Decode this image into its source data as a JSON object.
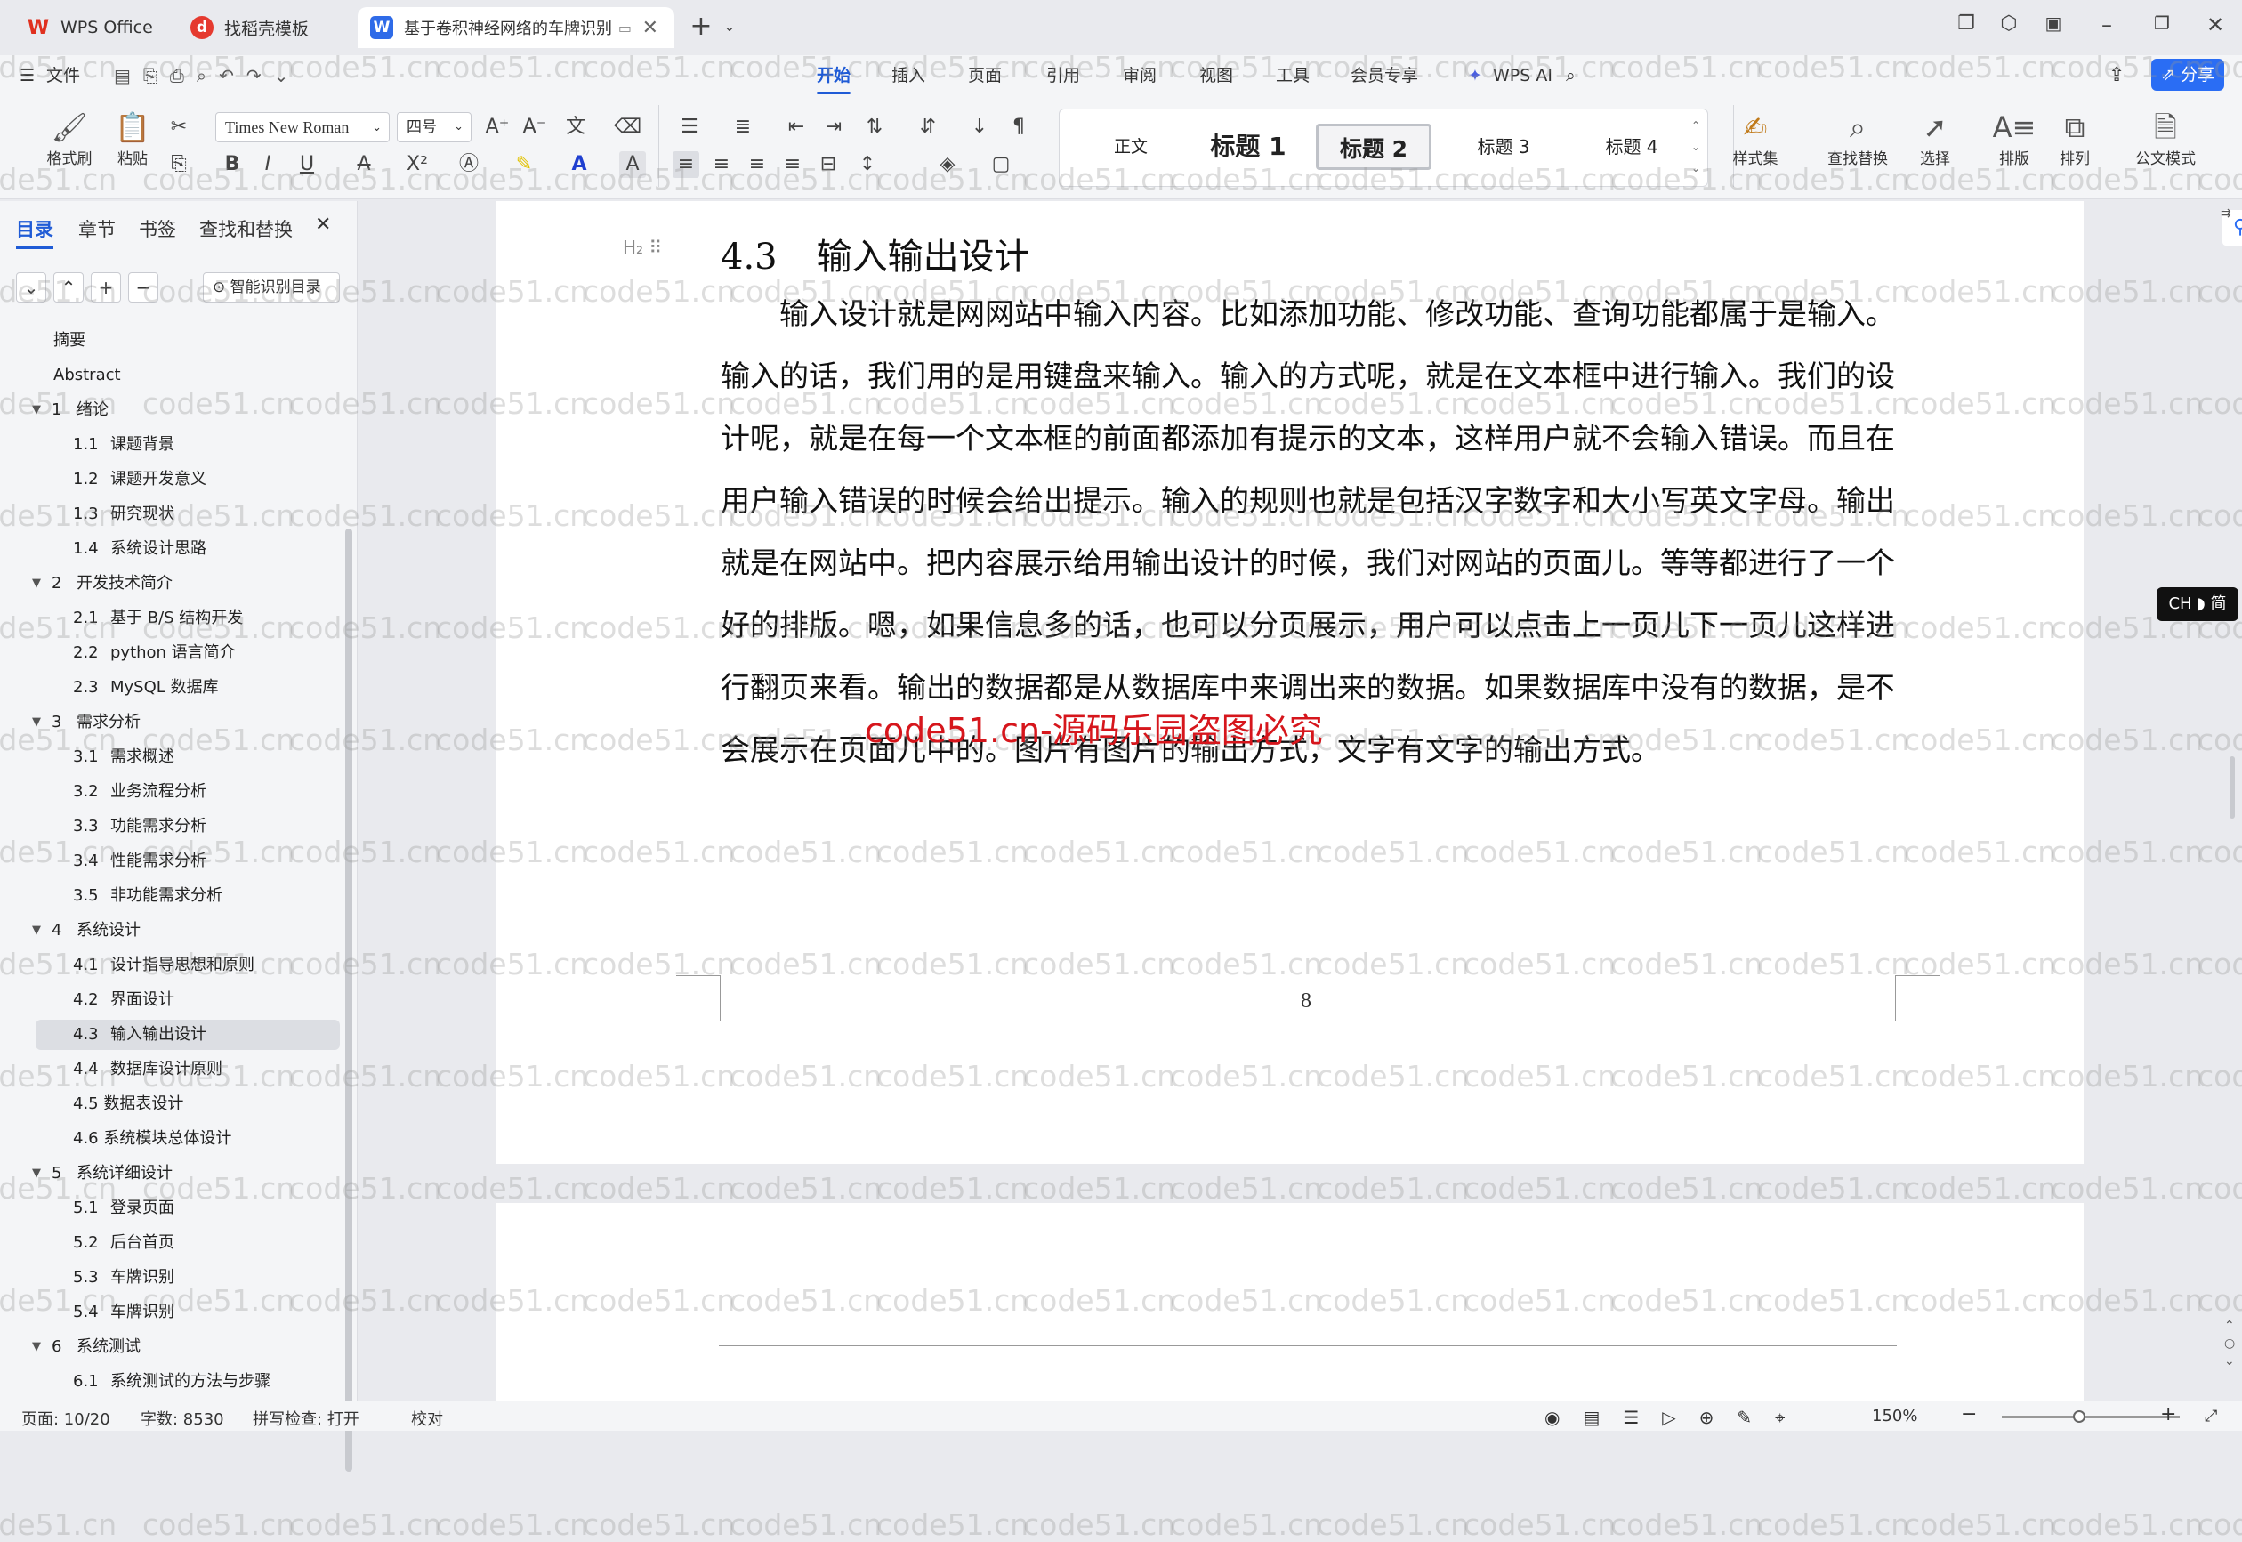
{
  "tabs": [
    {
      "label": "WPS Office",
      "icon": "wps-logo-icon"
    },
    {
      "label": "找稻壳模板",
      "icon": "docer-icon"
    },
    {
      "label": "基于卷积神经网络的车牌识别",
      "icon": "word-doc-icon"
    }
  ],
  "menu": {
    "file": "文件",
    "items": [
      "开始",
      "插入",
      "页面",
      "引用",
      "审阅",
      "视图",
      "工具",
      "会员专享"
    ],
    "wps_ai": "WPS AI",
    "share": "分享"
  },
  "toolbar": {
    "format_painter": "格式刷",
    "paste": "粘贴",
    "font_name": "Times New Roman",
    "font_size": "四号",
    "styles": [
      "正文",
      "标题 1",
      "标题 2",
      "标题 3",
      "标题 4"
    ],
    "style_set": "样式集",
    "find_replace": "查找替换",
    "select": "选择",
    "layout": "排版",
    "arrange": "排列",
    "official_mode": "公文模式"
  },
  "panel": {
    "tabs": [
      "目录",
      "章节",
      "书签",
      "查找和替换"
    ],
    "smart_toc": "智能识别目录",
    "toc": [
      {
        "num": "",
        "text": "摘要",
        "level": 0
      },
      {
        "num": "",
        "text": "Abstract",
        "level": 0
      },
      {
        "num": "1",
        "text": "绪论",
        "level": 1
      },
      {
        "num": "1.1",
        "text": "课题背景",
        "level": 2
      },
      {
        "num": "1.2",
        "text": "课题开发意义",
        "level": 2
      },
      {
        "num": "1.3",
        "text": "研究现状",
        "level": 2
      },
      {
        "num": "1.4",
        "text": "系统设计思路",
        "level": 2
      },
      {
        "num": "2",
        "text": "开发技术简介",
        "level": 1
      },
      {
        "num": "2.1",
        "text": "基于 B/S 结构开发",
        "level": 2
      },
      {
        "num": "2.2",
        "text": "python 语言简介",
        "level": 2
      },
      {
        "num": "2.3",
        "text": "MySQL 数据库",
        "level": 2
      },
      {
        "num": "3",
        "text": "需求分析",
        "level": 1
      },
      {
        "num": "3.1",
        "text": "需求概述",
        "level": 2
      },
      {
        "num": "3.2",
        "text": "业务流程分析",
        "level": 2
      },
      {
        "num": "3.3",
        "text": "功能需求分析",
        "level": 2
      },
      {
        "num": "3.4",
        "text": "性能需求分析",
        "level": 2
      },
      {
        "num": "3.5",
        "text": "非功能需求分析",
        "level": 2
      },
      {
        "num": "4",
        "text": "系统设计",
        "level": 1
      },
      {
        "num": "4.1",
        "text": "设计指导思想和原则",
        "level": 2
      },
      {
        "num": "4.2",
        "text": "界面设计",
        "level": 2
      },
      {
        "num": "4.3",
        "text": "输入输出设计",
        "level": 2
      },
      {
        "num": "4.4",
        "text": "数据库设计原则",
        "level": 2
      },
      {
        "num": "",
        "text": "4.5 数据表设计",
        "level": 2
      },
      {
        "num": "",
        "text": "4.6 系统模块总体设计",
        "level": 2
      },
      {
        "num": "5",
        "text": "系统详细设计",
        "level": 1
      },
      {
        "num": "5.1",
        "text": "登录页面",
        "level": 2
      },
      {
        "num": "5.2",
        "text": "后台首页",
        "level": 2
      },
      {
        "num": "5.3",
        "text": "车牌识别",
        "level": 2
      },
      {
        "num": "5.4",
        "text": "车牌识别",
        "level": 2
      },
      {
        "num": "6",
        "text": "系统测试",
        "level": 1
      },
      {
        "num": "6.1",
        "text": "系统测试的方法与步骤",
        "level": 2
      }
    ]
  },
  "doc": {
    "heading_num": "4.3",
    "heading_text": "输入输出设计",
    "heading_tag": "H₂",
    "paragraph": "输入设计就是网网站中输入内容。比如添加功能、修改功能、查询功能都属于是输入。输入的话，我们用的是用键盘来输入。输入的方式呢，就是在文本框中进行输入。我们的设计呢，就是在每一个文本框的前面都添加有提示的文本，这样用户就不会输入错误。而且在用户输入错误的时候会给出提示。输入的规则也就是包括汉字数字和大小写英文字母。输出就是在网站中。把内容展示给用输出设计的时候，我们对网站的页面儿。等等都进行了一个好的排版。嗯，如果信息多的话，也可以分页展示，用户可以点击上一页儿下一页儿这样进行翻页来看。输出的数据都是从数据库中来调出来的数据。如果数据库中没有的数据，是不会展示在页面儿中的。图片有图片的输出方式，文字有文字的输出方式。",
    "page_number": "8",
    "red_watermark": "code51.cn-源码乐园盗图必究",
    "watermark": "code51.cn"
  },
  "ime_badge": "CH ◗ 简",
  "status": {
    "page": "页面: 10/20",
    "words": "字数: 8530",
    "spell": "拼写检查: 打开",
    "proof": "校对",
    "zoom": "150%"
  },
  "colors": {
    "accent": "#1f5bd6",
    "share": "#2a6df4",
    "watermark_red": "#d6161c"
  }
}
